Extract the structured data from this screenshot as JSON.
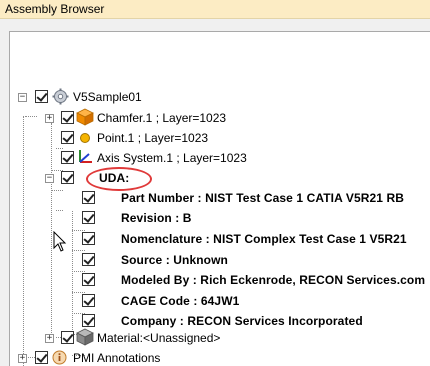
{
  "window": {
    "title": "Assembly Browser",
    "accent_color": "#fcecc4",
    "highlight_color": "#e03a3a"
  },
  "tree": {
    "root": {
      "label": "V5Sample01",
      "icon": "gear-product-icon",
      "expanded": true
    },
    "children": [
      {
        "label": "Chamfer.1 ; Layer=1023",
        "icon": "orange-cube-icon",
        "expandable": true
      },
      {
        "label": "Point.1 ; Layer=1023",
        "icon": "point-icon",
        "expandable": false
      },
      {
        "label": "Axis System.1 ; Layer=1023",
        "icon": "axis-system-icon",
        "expandable": false
      },
      {
        "label": "UDA:",
        "expanded": true,
        "highlighted": true
      }
    ],
    "uda_items": [
      "Part Number : NIST Test Case 1 CATIA V5R21 RB",
      "Revision : B",
      "Nomenclature : NIST Complex Test Case 1 V5R21",
      "Source : Unknown",
      "Modeled By : Rich Eckenrode, RECON Services.com",
      "CAGE Code : 64JW1",
      "Company : RECON Services Incorporated"
    ],
    "material": {
      "label": "Material:<Unassigned>",
      "icon": "material-cube-icon"
    },
    "pmi": {
      "label": "PMI Annotations",
      "icon": "pmi-info-icon"
    }
  }
}
